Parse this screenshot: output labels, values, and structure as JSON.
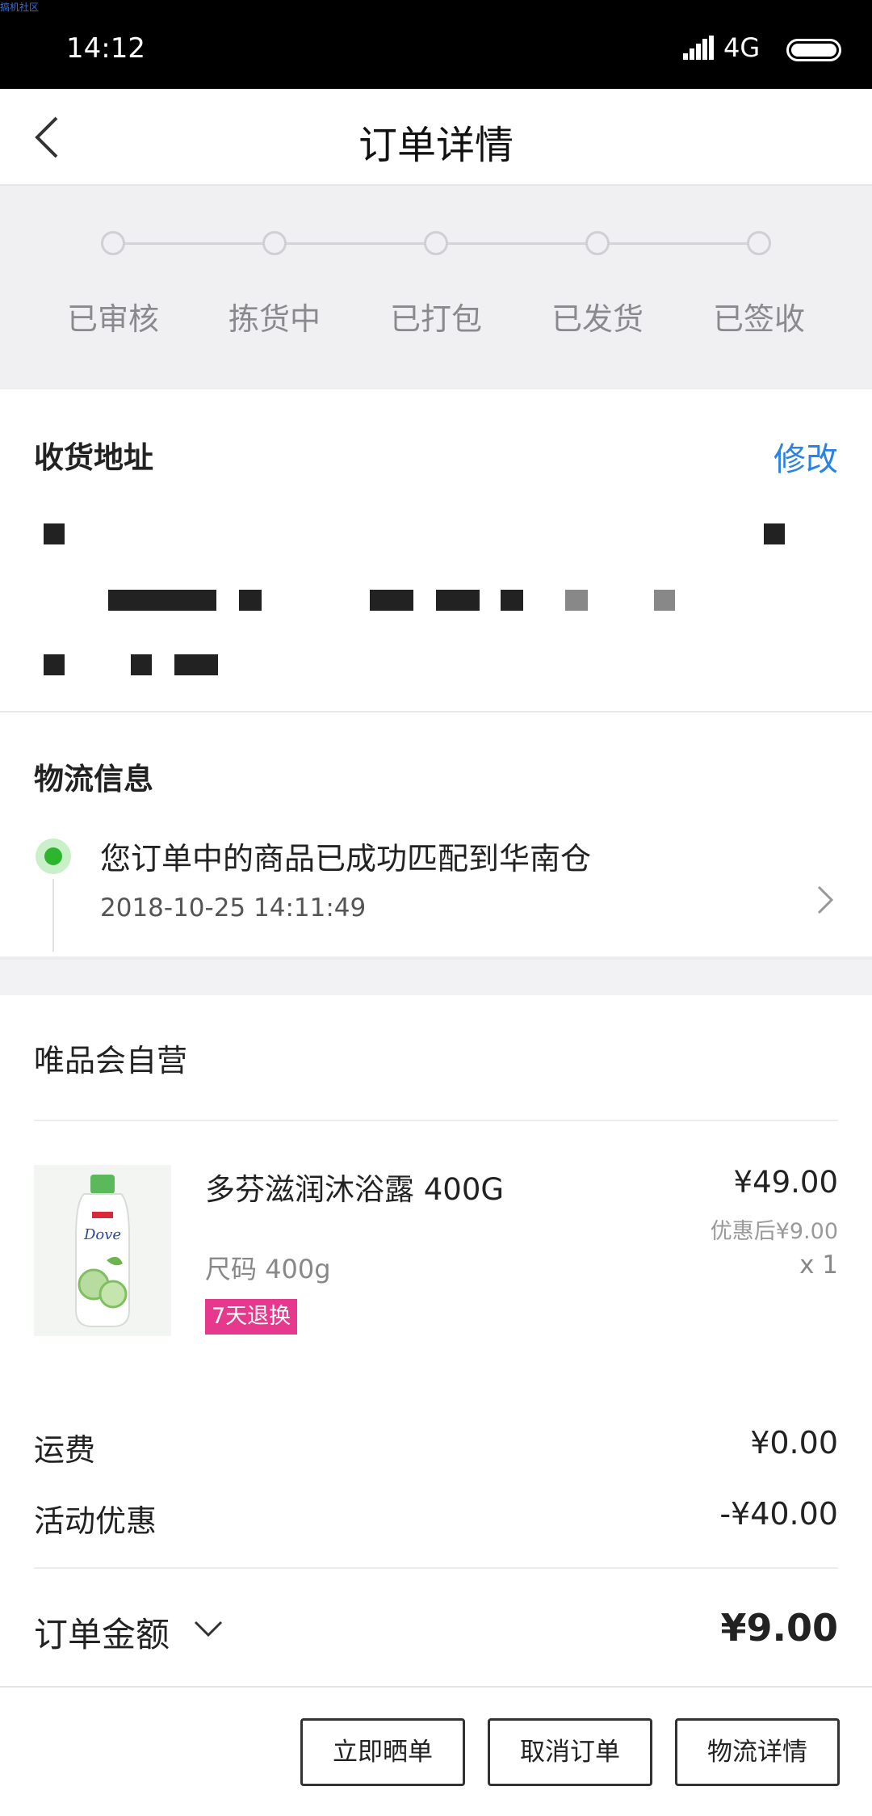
{
  "status_bar": {
    "watermark": "搞机社区",
    "time": "14:12",
    "network": "4G"
  },
  "header": {
    "title": "订单详情"
  },
  "steps": [
    "已审核",
    "拣货中",
    "已打包",
    "已发货",
    "已签收"
  ],
  "address": {
    "title": "收货地址",
    "edit_label": "修改"
  },
  "logistics": {
    "title": "物流信息",
    "message": "您订单中的商品已成功匹配到华南仓",
    "time": "2018-10-25 14:11:49"
  },
  "shop": {
    "name": "唯品会自营",
    "product": {
      "name": "多芬滋润沐浴露 400G",
      "spec": "尺码 400g",
      "tag": "7天退换",
      "price": "¥49.00",
      "discount_price": "优惠后¥9.00",
      "quantity": "x 1",
      "image_icon": "shower-gel-bottle-icon"
    }
  },
  "fees": {
    "shipping_label": "运费",
    "shipping_value": "¥0.00",
    "promo_label": "活动优惠",
    "promo_value": "-¥40.00"
  },
  "total": {
    "label": "订单金额",
    "amount": "¥9.00"
  },
  "actions": {
    "share": "立即晒单",
    "cancel": "取消订单",
    "logistics_detail": "物流详情"
  },
  "colors": {
    "accent_blue": "#2a82e4",
    "tag_pink": "#e6398d",
    "success_green": "#2db52d"
  }
}
